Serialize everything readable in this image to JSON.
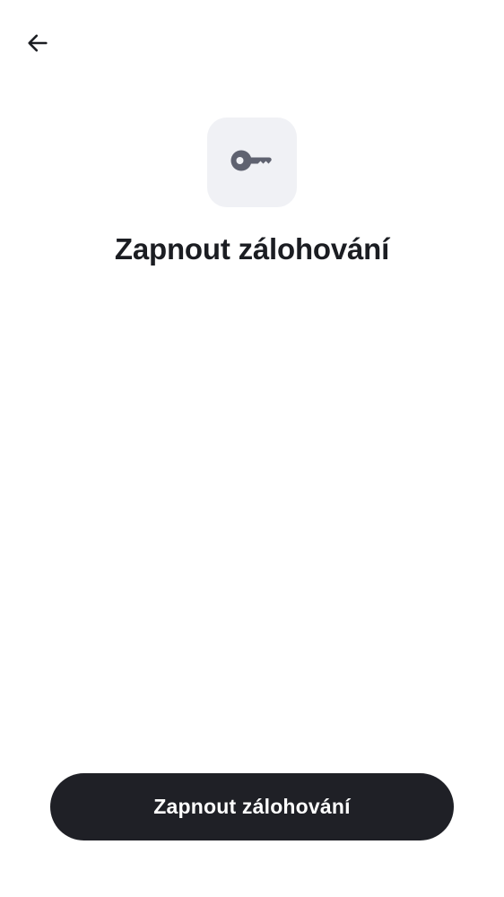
{
  "header": {
    "back_icon": "arrow-left-icon"
  },
  "hero": {
    "icon": "key-icon",
    "icon_color": "#5f6270",
    "tile_color": "#f0f1f5",
    "title": "Zapnout zálohování"
  },
  "footer": {
    "primary_button_label": "Zapnout zálohování",
    "button_color": "#1f2026"
  }
}
